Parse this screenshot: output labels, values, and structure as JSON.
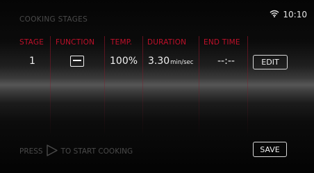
{
  "screen": {
    "title": "COOKING STAGES",
    "time": "10:10",
    "icons": {
      "wifi": "wifi-icon",
      "play": "play-outline-icon",
      "function": "function-mode-icon"
    }
  },
  "table": {
    "headers": [
      "STAGE",
      "FUNCTION",
      "TEMP.",
      "DURATION",
      "END TIME"
    ],
    "row": {
      "stage": "1",
      "temperature": "100%",
      "duration_value": "3.30",
      "duration_unit": "min/sec",
      "end_time": "--:--",
      "edit_label": "EDIT"
    }
  },
  "footer": {
    "press_text": "PRESS",
    "start_text": "TO START COOKING",
    "save_label": "SAVE"
  },
  "colors": {
    "accent_red": "#c0102a",
    "text_white": "#f0f0f0",
    "muted_gray": "#4a4a4a",
    "background": "#000000"
  }
}
